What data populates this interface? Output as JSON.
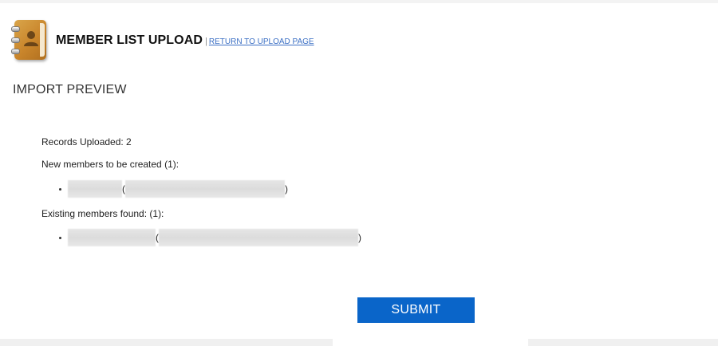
{
  "header": {
    "title": "MEMBER LIST UPLOAD",
    "separator": "|",
    "return_link": "RETURN TO UPLOAD PAGE",
    "icon": "address-book-icon"
  },
  "preview": {
    "title": "IMPORT PREVIEW",
    "records_uploaded": "Records Uploaded: 2",
    "new_members_label": "New members to be created (1):",
    "existing_members_label": "Existing members found: (1):",
    "paren_open": "(",
    "paren_close": ")"
  },
  "actions": {
    "submit_label": "SUBMIT"
  },
  "colors": {
    "submit_bg": "#0a65c9",
    "link": "#3b6fc4",
    "icon_cover": "#c9852b"
  }
}
